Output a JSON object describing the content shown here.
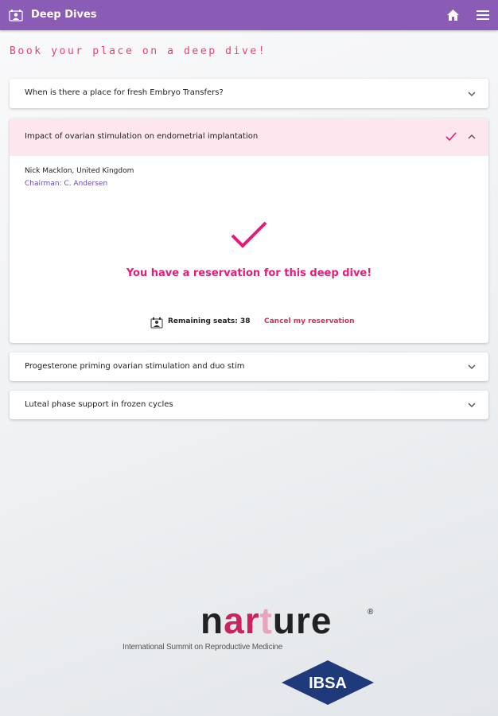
{
  "appbar": {
    "title": "Deep Dives",
    "icons": [
      "app-logo-icon",
      "home-icon",
      "menu-icon"
    ],
    "color": "#8a5cb6"
  },
  "subtitle": "Book your place on a deep dive!",
  "sessions": [
    {
      "title": "When is there a place for fresh Embryo Transfers?",
      "expanded": false
    },
    {
      "title": "Impact of ovarian stimulation on endometrial implantation",
      "expanded": true,
      "speaker": "Nick Macklon, United Kingdom",
      "chair": "Chairman: C. Andersen",
      "reservation_message": "You have a reservation for this deep dive!",
      "remaining_seats_label": "Remaining seats: 38",
      "cancel_label": "Cancel my reservation"
    },
    {
      "title": "Progesterone priming ovarian stimulation and duo stim",
      "expanded": false
    },
    {
      "title": "Luteal phase support in frozen cycles",
      "expanded": false
    }
  ],
  "footer": {
    "brand": "narture",
    "brand_mark": "®",
    "tagline": "International Summit on Reproductive Medicine",
    "sponsor": "IBSA"
  },
  "colors": {
    "accent_pink": "#e61a78",
    "header_highlight": "#fde6ee",
    "chair_purple": "#6a4bb0",
    "sponsor_navy": "#1f3a7a"
  }
}
